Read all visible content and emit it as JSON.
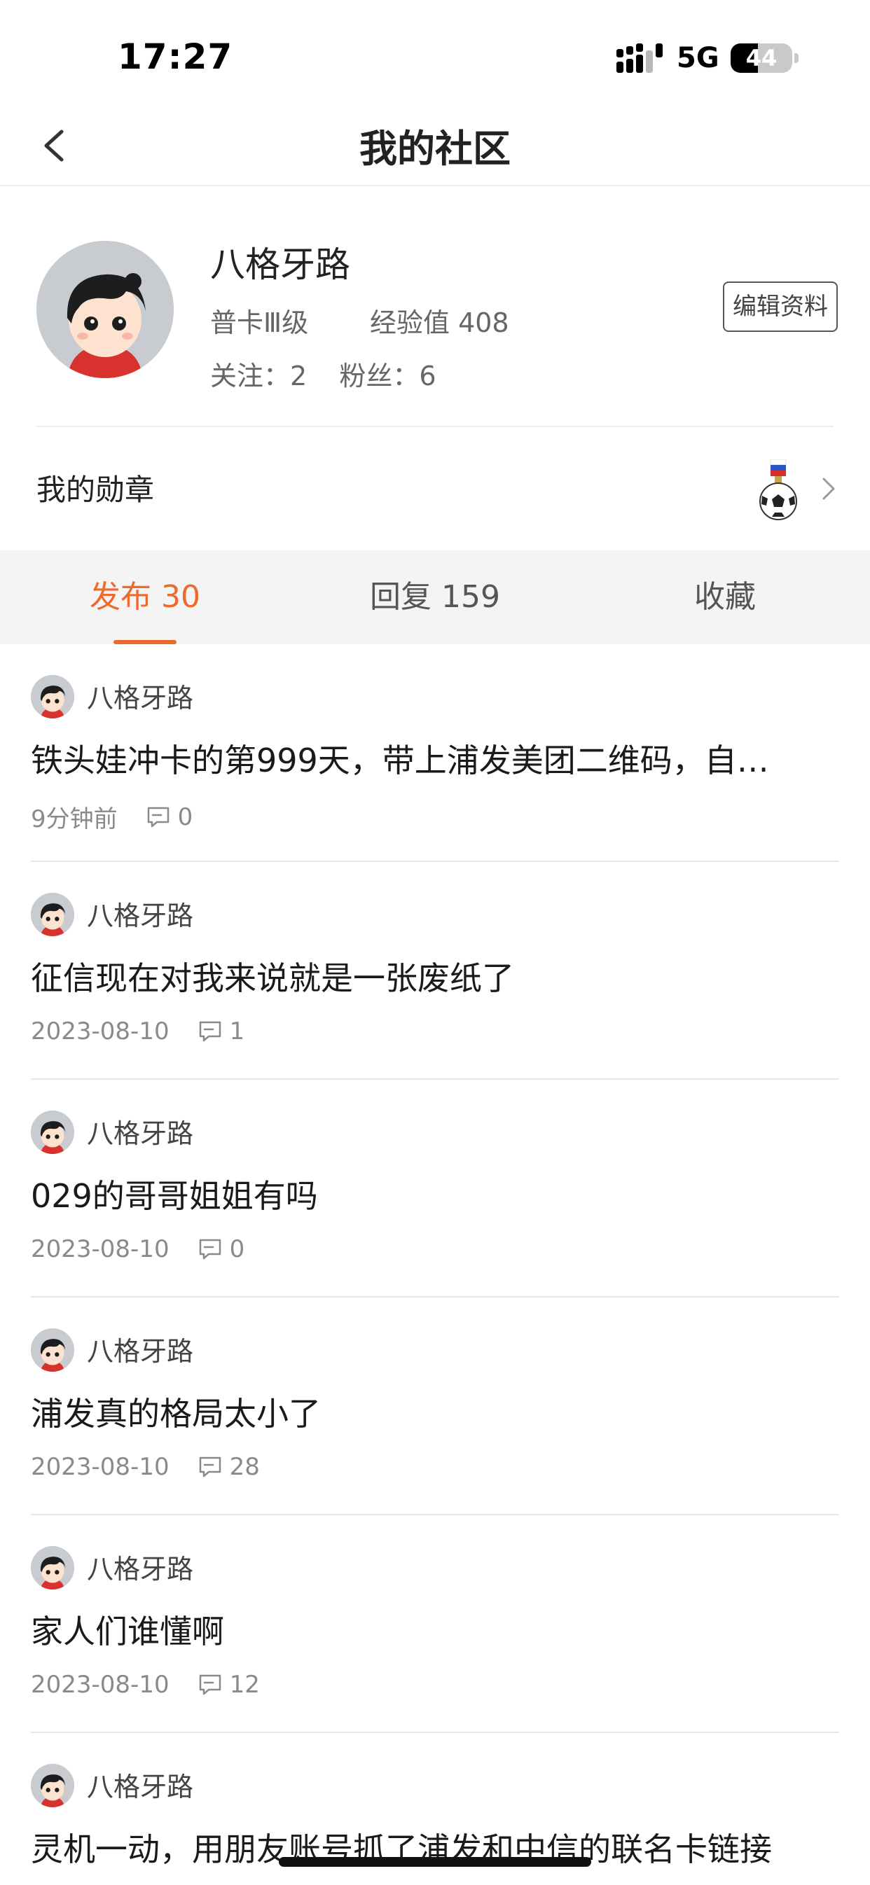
{
  "status_bar": {
    "time": "17:27",
    "network": "5G",
    "battery": "44",
    "battery_level": 0.44
  },
  "nav": {
    "title": "我的社区"
  },
  "profile": {
    "name": "八格牙路",
    "level": "普卡Ⅲ级",
    "experience": "经验值 408",
    "following": "关注：2",
    "followers": "粉丝：6",
    "edit_label": "编辑资料"
  },
  "medals": {
    "label": "我的勋章"
  },
  "tabs": [
    {
      "label": "发布 30",
      "active": true
    },
    {
      "label": "回复 159",
      "active": false
    },
    {
      "label": "收藏",
      "active": false
    }
  ],
  "posts": [
    {
      "author": "八格牙路",
      "title": "铁头娃冲卡的第999天，带上浦发美团二维码，自…",
      "time": "9分钟前",
      "comments": "0"
    },
    {
      "author": "八格牙路",
      "title": "征信现在对我来说就是一张废纸了",
      "time": "2023-08-10",
      "comments": "1"
    },
    {
      "author": "八格牙路",
      "title": "029的哥哥姐姐有吗",
      "time": "2023-08-10",
      "comments": "0"
    },
    {
      "author": "八格牙路",
      "title": "浦发真的格局太小了",
      "time": "2023-08-10",
      "comments": "28"
    },
    {
      "author": "八格牙路",
      "title": "家人们谁懂啊",
      "time": "2023-08-10",
      "comments": "12"
    },
    {
      "author": "八格牙路",
      "title": "灵机一动，用朋友账号抓了浦发和中信的联名卡链接",
      "time": "",
      "comments": ""
    }
  ],
  "colors": {
    "accent": "#ee6a2a",
    "tab_bg": "#f4f4f4",
    "divider": "#e8e8e8"
  },
  "icons": [
    "back-arrow-icon",
    "signal-icon",
    "battery-icon",
    "medal-icon",
    "chevron-right-icon",
    "comment-icon"
  ]
}
